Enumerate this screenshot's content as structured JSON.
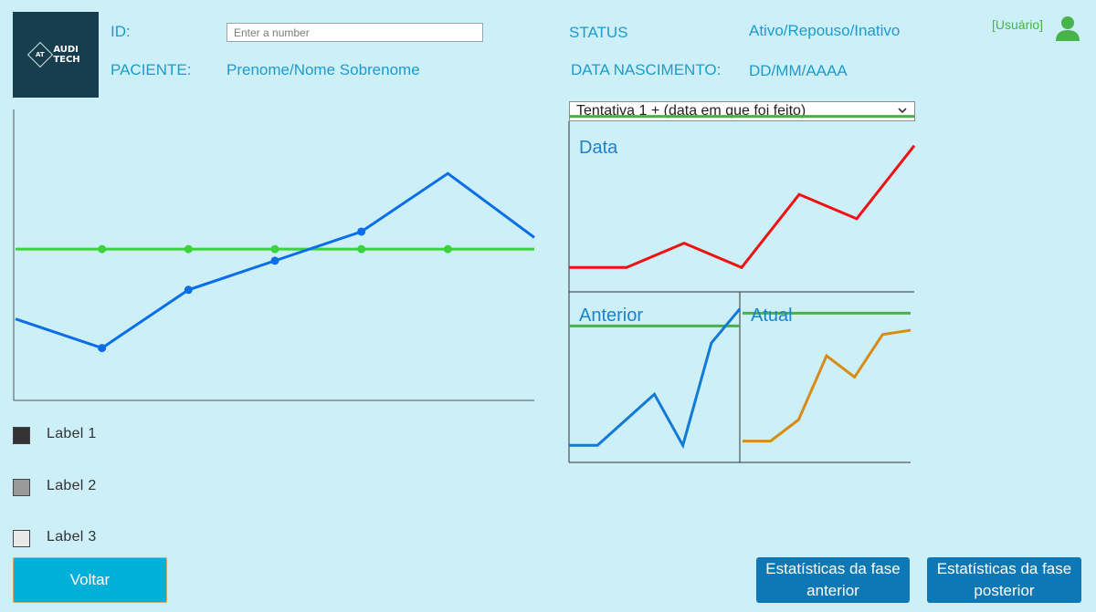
{
  "logo": {
    "mark": "AT",
    "line1": "AUDI",
    "line2": "TECH"
  },
  "header": {
    "id_label": "ID:",
    "id_placeholder": "Enter a number",
    "patient_label": "PACIENTE:",
    "patient_value": "Prenome/Nome Sobrenome",
    "status_label": "STATUS",
    "status_value": "Ativo/Repouso/Inativo",
    "birth_label": "DATA NASCIMENTO:",
    "birth_value": "DD/MM/AAAA",
    "user_label": "[Usuário]",
    "user_icon": "user-icon"
  },
  "attempt_select": {
    "value": "Tentativa 1 + (data em que foi feito)",
    "icon": "chevron-down-icon"
  },
  "panels": {
    "data_title": "Data",
    "anterior_title": "Anterior",
    "atual_title": "Atual"
  },
  "legend": [
    {
      "label": "Label 1",
      "color": "#333333"
    },
    {
      "label": "Label 2",
      "color": "#999999"
    },
    {
      "label": "Label 3",
      "color": "#e9e9e9"
    }
  ],
  "buttons": {
    "back": "Voltar",
    "prev_stats_line1": "Estatísticas da fase",
    "prev_stats_line2": "anterior",
    "next_stats_line1": "Estatísticas da fase",
    "next_stats_line2": "posterior"
  },
  "colors": {
    "main_line": "#0a6ee8",
    "reference_line": "#3ad33a",
    "data_line": "#ee1111",
    "panel_reference": "#48b04c",
    "anterior_line": "#1179d6",
    "atual_line": "#d88b15"
  },
  "chart_data": [
    {
      "type": "line",
      "grid": false,
      "series": [
        {
          "values": [
            28,
            18,
            38,
            48,
            58,
            78,
            56
          ]
        },
        {
          "values": [
            52,
            52,
            52,
            52,
            52,
            52,
            52
          ]
        }
      ],
      "ylim": [
        0,
        100
      ]
    },
    {
      "type": "line",
      "series": [
        {
          "values": [
            10,
            10,
            20,
            10,
            40,
            30,
            60
          ]
        },
        {
          "values": [
            72
          ]
        }
      ],
      "ylim": [
        0,
        70
      ]
    },
    {
      "type": "line",
      "series": [
        {
          "values": [
            10,
            10,
            25,
            40,
            10,
            70,
            90
          ]
        },
        {
          "values": [
            80
          ]
        }
      ],
      "ylim": [
        0,
        100
      ]
    },
    {
      "type": "line",
      "series": [
        {
          "values": [
            10,
            10,
            20,
            50,
            40,
            60,
            62
          ]
        },
        {
          "values": [
            70
          ]
        }
      ],
      "ylim": [
        0,
        80
      ]
    }
  ]
}
